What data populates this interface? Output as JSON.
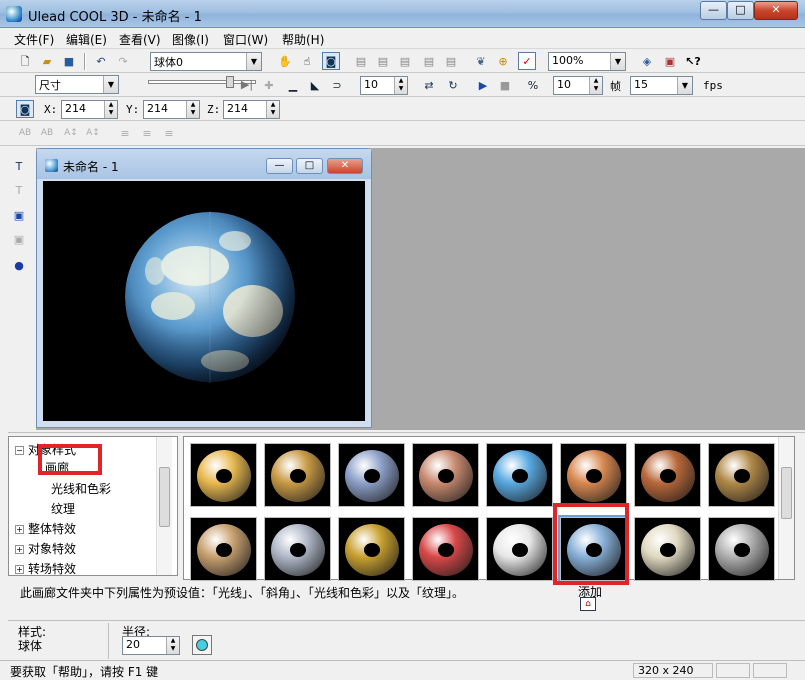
{
  "window": {
    "title": "Ulead COOL 3D - 未命名 - 1",
    "minimize": "—",
    "maximize": "□",
    "close": "✕"
  },
  "menu": [
    "文件(F)",
    "编辑(E)",
    "查看(V)",
    "图像(I)",
    "窗口(W)",
    "帮助(H)"
  ],
  "toolbar1": {
    "object_combo": "球体0",
    "zoom_combo": "100%"
  },
  "toolbar2": {
    "attr_combo": "尺寸",
    "frame_value": "10",
    "frames_value": "10",
    "frames_label": "帧",
    "fps_value": "15",
    "fps_label": "fps"
  },
  "toolbar3": {
    "x_label": "X:",
    "x_value": "214",
    "y_label": "Y:",
    "y_value": "214",
    "z_label": "Z:",
    "z_value": "214"
  },
  "doc": {
    "title": "未命名 - 1"
  },
  "tree": {
    "root_label": "对象样式",
    "items": [
      {
        "label": "画廊"
      },
      {
        "label": "光线和色彩"
      },
      {
        "label": "纹理"
      }
    ],
    "groups": [
      {
        "label": "整体特效"
      },
      {
        "label": "对象特效"
      },
      {
        "label": "转场特效"
      }
    ]
  },
  "gallery": {
    "thumbs": [
      {
        "icon": "gold-torus",
        "color": "#e8b850"
      },
      {
        "icon": "brass-torus",
        "color": "#c89a45"
      },
      {
        "icon": "chrome-dark-torus",
        "color": "#8da0c8"
      },
      {
        "icon": "copper-torus",
        "color": "#c88a70"
      },
      {
        "icon": "blue-stone-torus",
        "color": "#58a8e0"
      },
      {
        "icon": "orange-ring-torus",
        "color": "#d88850"
      },
      {
        "icon": "terracotta-torus",
        "color": "#b8683a"
      },
      {
        "icon": "bronze-torus",
        "color": "#b08848"
      },
      {
        "icon": "cork-torus",
        "color": "#c8a070"
      },
      {
        "icon": "perforated-torus",
        "color": "#b0b8c8"
      },
      {
        "icon": "dotted-gold-torus",
        "color": "#c8a030"
      },
      {
        "icon": "stained-glass-torus",
        "color": "#d84848"
      },
      {
        "icon": "white-spotted-torus",
        "color": "#e8e8e8"
      },
      {
        "icon": "sky-cloud-torus",
        "color": "#88b0d8"
      },
      {
        "icon": "pearl-torus",
        "color": "#e0d8c0"
      },
      {
        "icon": "silver-studded-torus",
        "color": "#b0b0b0"
      }
    ],
    "selected_index": 13
  },
  "description": "此画廊文件夹中下列属性为预设值：「光线」、「斜角」、「光线和色彩」以及「纹理」。",
  "add_label": "添加",
  "props": {
    "style_label": "样式:",
    "style_value": "球体",
    "radius_label": "半径:",
    "radius_value": "20"
  },
  "status": {
    "help_text": "要获取「帮助」，请按 F1 键",
    "size_text": "320 x 240"
  },
  "colors": {
    "accent_red": "#e0252a",
    "color_swatch": "#40d0e0"
  }
}
